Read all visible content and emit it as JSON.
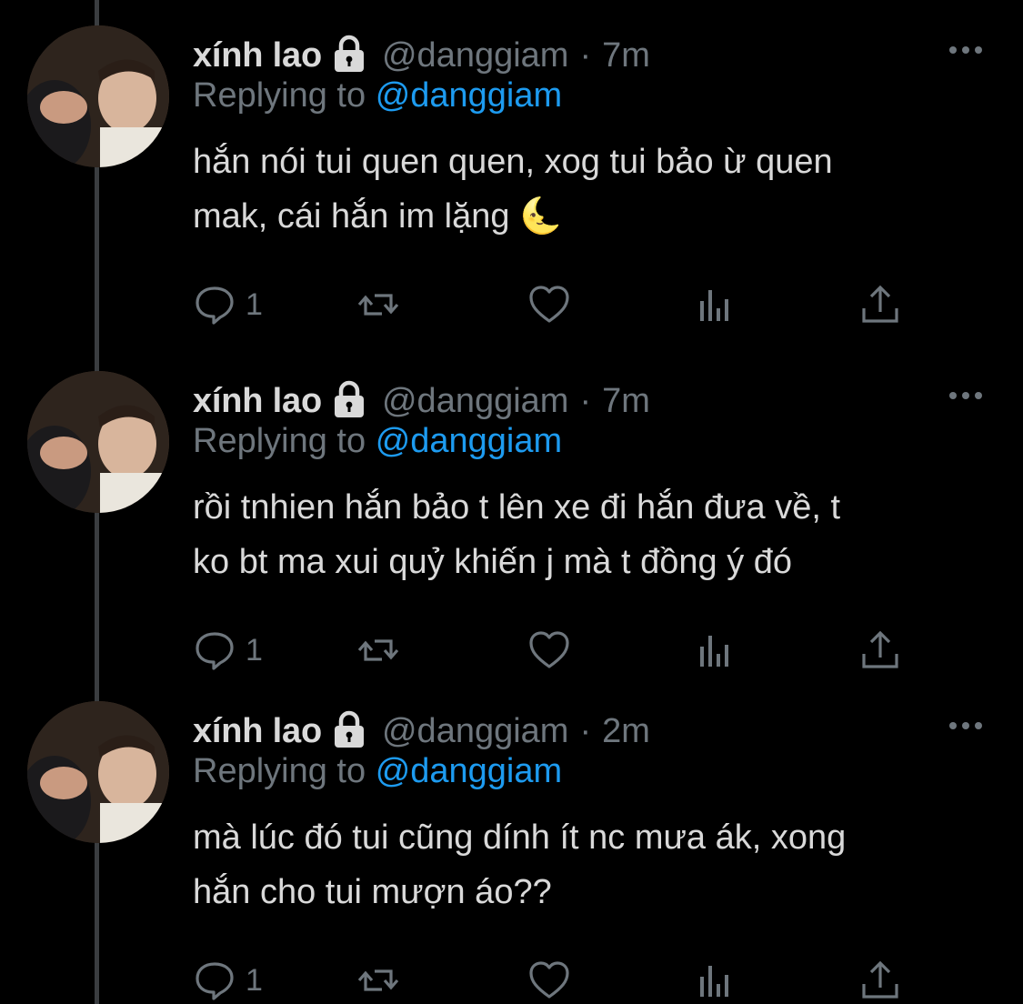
{
  "tweets": [
    {
      "name": "xính lao",
      "handle": "@danggiam",
      "separator": "·",
      "time": "7m",
      "replying_prefix": "Replying to",
      "replying_to": "@danggiam",
      "text_line1": "hắn nói tui quen quen, xog tui bảo ừ quen",
      "text_line2": "mak, cái hắn im lặng 🌜",
      "reply_count": "1"
    },
    {
      "name": "xính lao",
      "handle": "@danggiam",
      "separator": "·",
      "time": "7m",
      "replying_prefix": "Replying to",
      "replying_to": "@danggiam",
      "text_line1": "rồi tnhien hắn bảo t lên xe đi hắn đưa về, t",
      "text_line2": "ko bt ma xui quỷ khiến j mà t đồng ý đó",
      "reply_count": "1"
    },
    {
      "name": "xính lao",
      "handle": "@danggiam",
      "separator": "·",
      "time": "2m",
      "replying_prefix": "Replying to",
      "replying_to": "@danggiam",
      "text_line1": "mà lúc đó tui cũng dính ít nc mưa ák, xong",
      "text_line2": "hắn cho tui mượn áo??",
      "reply_count": "1"
    }
  ],
  "icons": {
    "protected": "lock-icon",
    "more": "more-icon",
    "reply": "reply-icon",
    "retweet": "retweet-icon",
    "like": "heart-icon",
    "analytics": "analytics-icon",
    "share": "share-icon"
  },
  "colors": {
    "background": "#000000",
    "text": "#d9d9d9",
    "secondary": "#6e767d",
    "link": "#1d9bf0",
    "thread_line": "#3a3d40"
  }
}
